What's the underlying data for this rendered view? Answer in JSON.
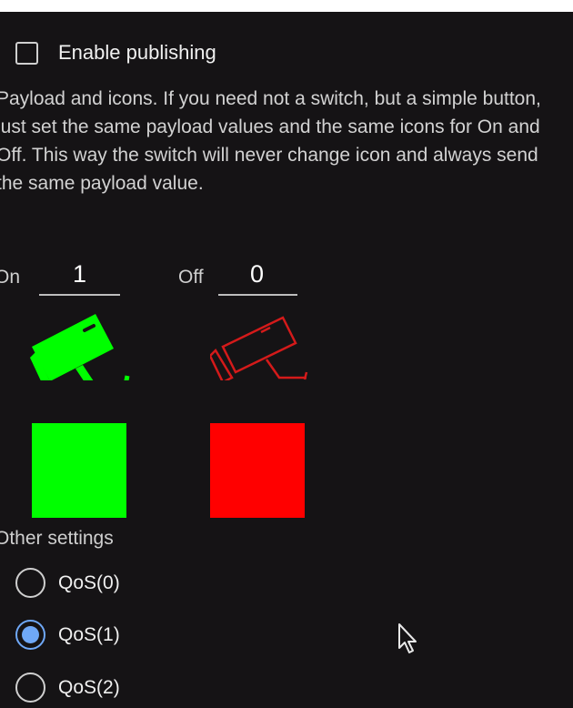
{
  "publishing": {
    "label": "Enable publishing",
    "checked": false
  },
  "description": "Payload and icons. If you need not a switch, but a simple button, just set the same payload values and the same icons for On and Off. This way the switch will never change icon and always send the same payload value.",
  "payload": {
    "on": {
      "label": "On",
      "value": "1",
      "icon": "security-camera-icon",
      "color": "#00ff00"
    },
    "off": {
      "label": "Off",
      "value": "0",
      "icon": "security-camera-outline-icon",
      "color": "#ff0000"
    }
  },
  "other_settings": {
    "title": "Other settings",
    "qos_options": [
      {
        "label": "QoS(0)",
        "selected": false
      },
      {
        "label": "QoS(1)",
        "selected": true
      },
      {
        "label": "QoS(2)",
        "selected": false
      }
    ],
    "accent_color": "#6fa8f7"
  }
}
